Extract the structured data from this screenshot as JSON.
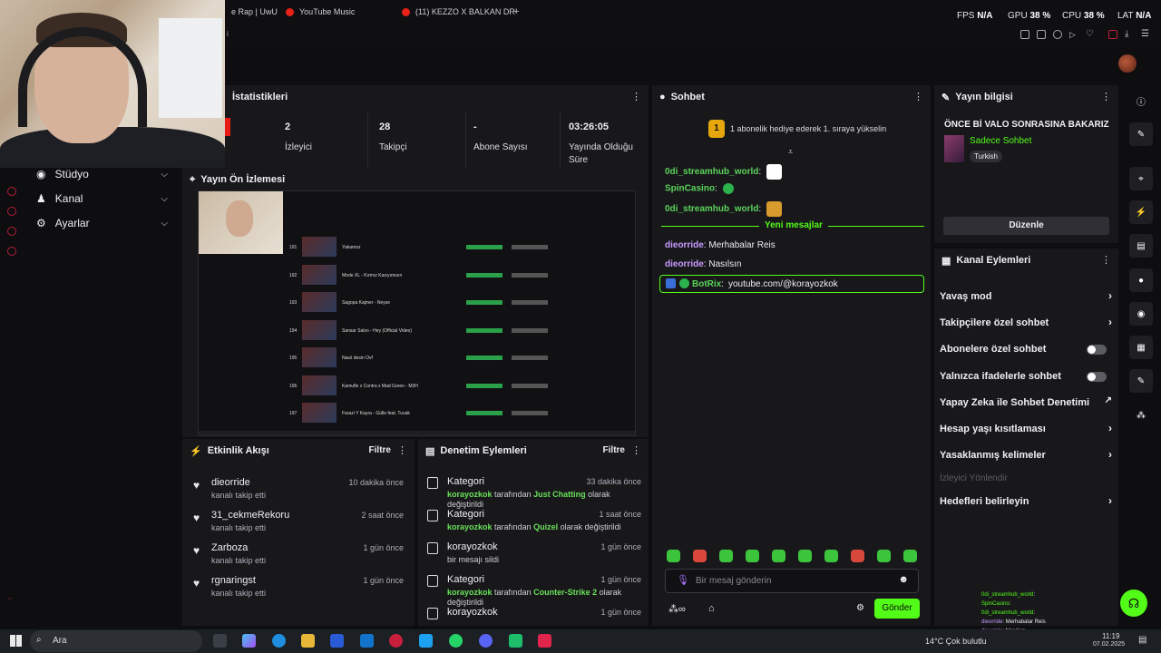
{
  "browser": {
    "tabs": [
      {
        "label": "e Rap | UwU"
      },
      {
        "label": "YouTube Music"
      },
      {
        "label": "(11) KEZZO X BALKAN DR"
      }
    ],
    "new_tab": "+",
    "perf": {
      "fps_label": "FPS",
      "fps": "N/A",
      "gpu_label": "GPU",
      "gpu": "38 %",
      "cpu_label": "CPU",
      "cpu": "38 %",
      "lat_label": "LAT",
      "lat": "N/A"
    },
    "breadcrumb_fragment": "i"
  },
  "nav": {
    "items": [
      {
        "label": "Stüdyo"
      },
      {
        "label": "Kanal"
      },
      {
        "label": "Ayarlar"
      }
    ]
  },
  "stats": {
    "title": "İstatistikleri",
    "items": [
      {
        "value": "2",
        "label": "İzleyici"
      },
      {
        "value": "28",
        "label": "Takipçi"
      },
      {
        "value": "-",
        "label": "Abone Sayısı"
      },
      {
        "value": "03:26:05",
        "label": "Yayında Olduğu Süre"
      }
    ]
  },
  "preview": {
    "title": "Yayın Ön İzlemesi",
    "rows": [
      {
        "num": "191",
        "name": "Yakamoz"
      },
      {
        "num": "192",
        "name": "Mode XL - Kırmız Kazıyımısın"
      },
      {
        "num": "193",
        "name": "Sagopa Kajmer - Neyse"
      },
      {
        "num": "194",
        "name": "Sansar Salvo - Hey (Official Video)"
      },
      {
        "num": "195",
        "name": "Nasıl desin Ovf"
      },
      {
        "num": "196",
        "name": "Kamufle x Contra x Mad Green - M3H"
      },
      {
        "num": "197",
        "name": "Farazi Y Kayra - Gülle feat. Tuvak"
      }
    ]
  },
  "activity": {
    "title": "Etkinlik Akışı",
    "filter": "Filtre",
    "items": [
      {
        "user": "dieorride",
        "action": "kanalı takip etti",
        "time": "10 dakika önce"
      },
      {
        "user": "31_cekmeRekoru",
        "action": "kanalı takip etti",
        "time": "2 saat önce"
      },
      {
        "user": "Zarboza",
        "action": "kanalı takip etti",
        "time": "1 gün önce"
      },
      {
        "user": "rgnaringst",
        "action": "kanalı takip etti",
        "time": "1 gün önce"
      }
    ]
  },
  "moderation": {
    "title": "Denetim Eylemleri",
    "filter": "Filtre",
    "items": [
      {
        "title": "Kategori",
        "actor": "korayozkok",
        "mid": "tarafından",
        "target": "Just Chatting",
        "tail": "olarak değiştirildi",
        "time": "33 dakika önce"
      },
      {
        "title": "Kategori",
        "actor": "korayozkok",
        "mid": "tarafından",
        "target": "Quizel",
        "tail": "olarak değiştirildi",
        "time": "1 saat önce"
      },
      {
        "title": "korayozkok",
        "actor": "",
        "mid": "bir mesajı sildi",
        "target": "",
        "tail": "",
        "time": "1 gün önce"
      },
      {
        "title": "Kategori",
        "actor": "korayozkok",
        "mid": "tarafından",
        "target": "Counter-Strike 2",
        "tail": "olarak değiştirildi",
        "time": "1 gün önce"
      },
      {
        "title": "korayozkok",
        "actor": "",
        "mid": "",
        "target": "",
        "tail": "",
        "time": "1 gün önce"
      }
    ]
  },
  "chat": {
    "title": "Sohbet",
    "gift_rank": "1",
    "gift_text": "1 abonelik hediye ederek 1. sıraya yükselin",
    "messages": [
      {
        "user": "0di_streamhub_world",
        "text": ""
      },
      {
        "user": "SpinCasino",
        "text": ""
      },
      {
        "user": "0di_streamhub_world",
        "text": ""
      }
    ],
    "new_messages": "Yeni mesajlar",
    "new": [
      {
        "user": "dieorride",
        "text": "Merhabalar Reis"
      },
      {
        "user": "dieorride",
        "text": "Nasılsın"
      }
    ],
    "bot": {
      "user": "BotRix",
      "text": "youtube.com/@korayozkok"
    },
    "input_placeholder": "Bir mesaj gönderin",
    "send": "Gönder",
    "colors": {
      "green": "#53fc18",
      "purple": "#c99cff"
    }
  },
  "stream_info": {
    "title": "Yayın bilgisi",
    "stream_title": "ÖNCE Bİ VALO SONRASINA BAKARIZ",
    "category": "Sadece Sohbet",
    "language": "Turkish",
    "edit": "Düzenle"
  },
  "channel_actions": {
    "title": "Kanal Eylemleri",
    "items": [
      {
        "label": "Yavaş mod",
        "kind": "arrow"
      },
      {
        "label": "Takipçilere özel sohbet",
        "kind": "arrow"
      },
      {
        "label": "Abonelere özel sohbet",
        "kind": "toggle"
      },
      {
        "label": "Yalnızca ifadelerle sohbet",
        "kind": "toggle"
      },
      {
        "label": "Yapay Zeka ile Sohbet Denetimi",
        "kind": "external"
      },
      {
        "label": "Hesap yaşı kısıtlaması",
        "kind": "arrow"
      },
      {
        "label": "Yasaklanmış kelimeler",
        "kind": "arrow"
      },
      {
        "label": "İzleyici Yönlendir",
        "kind": "disabled"
      },
      {
        "label": "Hedefleri belirleyin",
        "kind": "arrow"
      }
    ]
  },
  "overlay_chat": [
    {
      "user": "0di_streamhub_world",
      "text": ""
    },
    {
      "user": "SpinCasino",
      "text": ""
    },
    {
      "user": "0di_streamhub_world",
      "text": ""
    },
    {
      "user": "dieorride",
      "text": "Merhabalar Reis"
    },
    {
      "user": "dieorride",
      "text": "Nasılsın"
    },
    {
      "user": "BotRix",
      "text": "youtube.com/@korayozkok"
    }
  ],
  "taskbar": {
    "search_placeholder": "Ara",
    "weather": "14°C  Çok bulutlu",
    "time": "11:19",
    "date": "07.02.2025"
  }
}
